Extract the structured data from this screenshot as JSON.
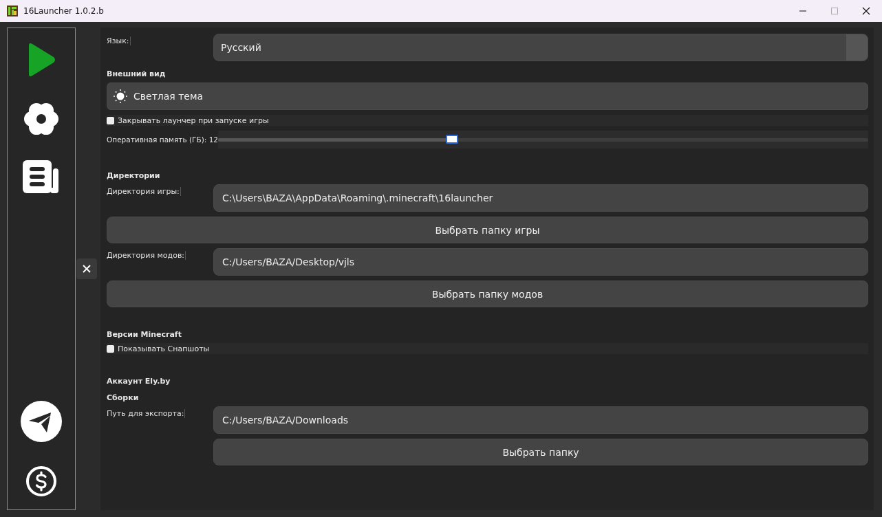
{
  "window": {
    "title": "16Launcher 1.0.2.b"
  },
  "settings": [
    {
      "kind": "select",
      "label": "Язык:",
      "value": "Русский"
    },
    {
      "kind": "heading",
      "text": "Внешний вид"
    },
    {
      "kind": "theme-button",
      "text": "Светлая тема"
    },
    {
      "kind": "checkbox",
      "text": "Закрывать лаунчер при запуске игры",
      "checked": false
    },
    {
      "kind": "slider",
      "label": "Оперативная память (ГБ): 12",
      "level": 0.36
    },
    {
      "kind": "heading",
      "text": "Директории"
    },
    {
      "kind": "field",
      "label": "Директория игры:",
      "value": "C:\\Users\\BAZA\\AppData\\Roaming\\.minecraft\\16launcher"
    },
    {
      "kind": "wide-button",
      "text": "Выбрать папку игры"
    },
    {
      "kind": "field",
      "label": "Директория модов:",
      "value": "C:/Users/BAZA/Desktop/vjls"
    },
    {
      "kind": "wide-button",
      "text": "Выбрать папку модов"
    },
    {
      "kind": "heading",
      "text": "Версии Minecraft"
    },
    {
      "kind": "checkbox",
      "text": "Показывать Снапшоты",
      "checked": false
    },
    {
      "kind": "heading",
      "text": "Аккаунт Ely.by"
    },
    {
      "kind": "heading",
      "text": "Сборки"
    },
    {
      "kind": "field",
      "label": "Путь для экспорта:",
      "value": "C:/Users/BAZA/Downloads"
    },
    {
      "kind": "button",
      "text": "Выбрать папку"
    }
  ]
}
